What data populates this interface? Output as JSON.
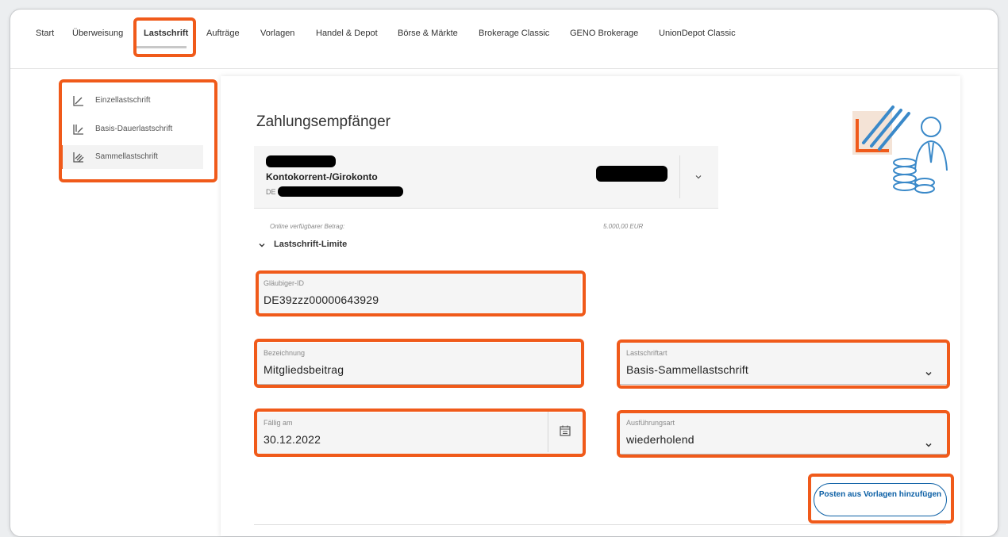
{
  "topnav": {
    "items": [
      {
        "label": "Start"
      },
      {
        "label": "Überweisung"
      },
      {
        "label": "Lastschrift"
      },
      {
        "label": "Aufträge"
      },
      {
        "label": "Vorlagen"
      },
      {
        "label": "Handel & Depot"
      },
      {
        "label": "Börse & Märkte"
      },
      {
        "label": "Brokerage Classic"
      },
      {
        "label": "GENO Brokerage"
      },
      {
        "label": "UnionDepot Classic"
      }
    ],
    "active": "Lastschrift"
  },
  "sidebar": {
    "items": [
      {
        "label": "Einzellastschrift",
        "icon": "single-debit-icon"
      },
      {
        "label": "Basis-Dauerlastschrift",
        "icon": "standing-debit-icon"
      },
      {
        "label": "Sammellastschrift",
        "icon": "collective-debit-icon"
      }
    ],
    "active": "Sammellastschrift"
  },
  "form": {
    "title": "Zahlungsempfänger",
    "account": {
      "type": "Kontokorrent-/Girokonto",
      "iban_prefix": "DE"
    },
    "available_label": "Online verfügbarer Betrag:",
    "available_value": "5.000,00 EUR",
    "limit_toggle": "Lastschrift-Limite",
    "glaeubiger_label": "Gläubiger-ID",
    "glaeubiger_value": "DE39zzz00000643929",
    "bezeichnung_label": "Bezeichnung",
    "bezeichnung_value": "Mitgliedsbeitrag",
    "lastschriftart_label": "Lastschriftart",
    "lastschriftart_value": "Basis-Sammellastschrift",
    "faellig_label": "Fällig am",
    "faellig_value": "30.12.2022",
    "ausfuehrung_label": "Ausführungsart",
    "ausfuehrung_value": "wiederholend",
    "add_button_label": "Posten aus Vorlagen hinzufügen"
  },
  "colors": {
    "highlight": "#f05a1a",
    "accent_blue": "#0b5fa5"
  }
}
